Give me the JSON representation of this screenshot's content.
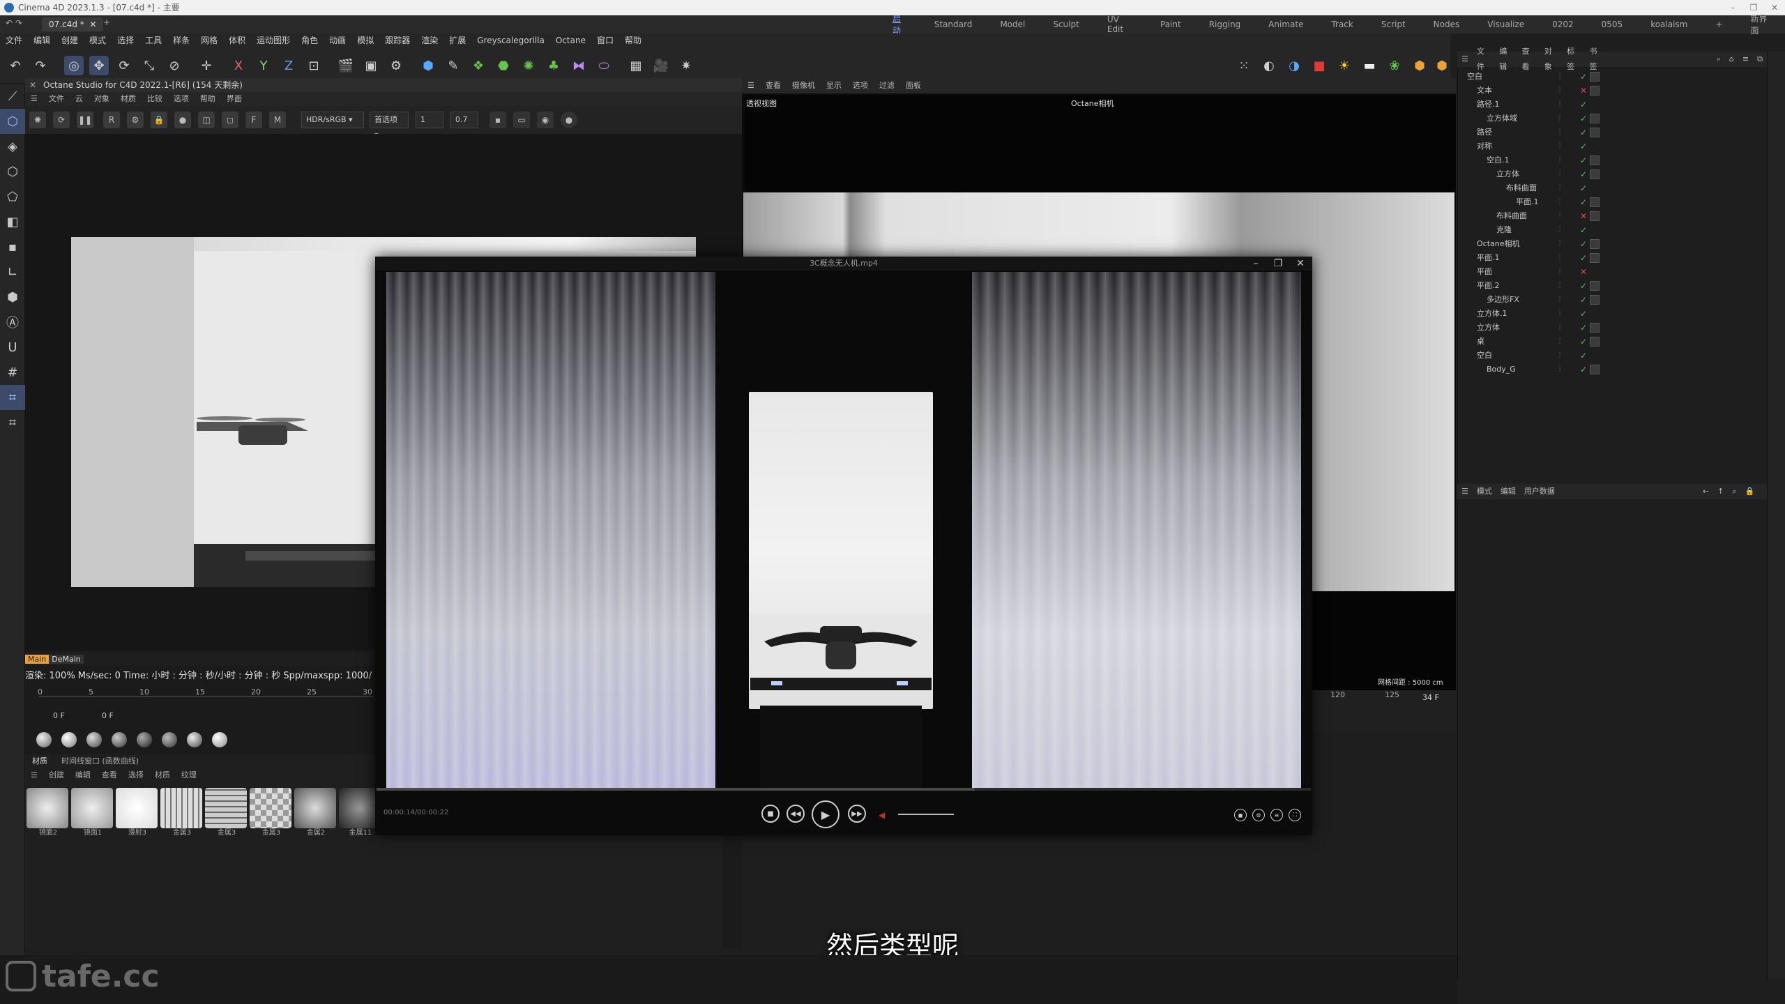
{
  "window": {
    "title": "Cinema 4D 2023.1.3 - [07.c4d *] - 主要"
  },
  "layout_bar": {
    "doc_tab": "07.c4d *",
    "layouts": [
      "启动",
      "Standard",
      "Model",
      "Sculpt",
      "UV Edit",
      "Paint",
      "Rigging",
      "Animate",
      "Track",
      "Script",
      "Nodes",
      "Visualize",
      "0202",
      "0505",
      "koalaism"
    ],
    "active_layout": "启动",
    "new_interface": "新界面"
  },
  "menu": [
    "文件",
    "编辑",
    "创建",
    "模式",
    "选择",
    "工具",
    "样条",
    "网格",
    "体积",
    "运动图形",
    "角色",
    "动画",
    "模拟",
    "跟踪器",
    "渲染",
    "扩展",
    "Greyscalegorilla",
    "Octane",
    "窗口",
    "帮助"
  ],
  "octane_viewer": {
    "title": "Octane Studio for C4D 2022.1-[R6] (154 天剩余)",
    "menu": [
      "文件",
      "云",
      "对象",
      "材质",
      "比较",
      "选项",
      "帮助",
      "界面"
    ],
    "mode": "HDR/sRGB",
    "pass": "首选项",
    "value1": "1",
    "value2": "0.7",
    "tag_main": "Main",
    "tag_demain": "DeMain",
    "status": "渲染: 100%   Ms/sec: 0   Time: 小时 : 分钟 : 秒/小时 : 分钟 : 秒   Spp/maxspp: 1000/",
    "timeline_ticks": [
      "0",
      "5",
      "10",
      "15",
      "20",
      "25",
      "30"
    ],
    "frame_start": "0 F",
    "frame_cur": "0 F"
  },
  "material_manager": {
    "tabs": [
      "材质",
      "时间线窗口 (函数曲线)"
    ],
    "menu": [
      "创建",
      "编辑",
      "查看",
      "选择",
      "材质",
      "纹理"
    ],
    "materials": [
      {
        "name": "镜面2",
        "color": "#b9b9b9"
      },
      {
        "name": "镜面1",
        "color": "#c4c4c4"
      },
      {
        "name": "漫射3",
        "color": "#ffffff"
      },
      {
        "name": "金属3",
        "color": "#dcdcdc"
      },
      {
        "name": "金属3",
        "color": "#cfcfcf"
      },
      {
        "name": "金属3",
        "color": "#e0e0e0"
      },
      {
        "name": "金属2",
        "color": "#bdbdbd"
      },
      {
        "name": "金属11",
        "color": "#555555"
      }
    ]
  },
  "viewport": {
    "menu": [
      "查看",
      "摄像机",
      "显示",
      "选项",
      "过滤",
      "面板"
    ],
    "label": "透视视图",
    "camera": "Octane相机",
    "grid_label": "网格间距 : 5000 cm",
    "frame": "34 F",
    "ticks": [
      "120",
      "125"
    ]
  },
  "object_manager": {
    "menu": [
      "文件",
      "编辑",
      "查看",
      "对象",
      "标签",
      "书签"
    ],
    "items": [
      {
        "name": "空白",
        "indent": 0
      },
      {
        "name": "文本",
        "indent": 1
      },
      {
        "name": "路径.1",
        "indent": 1
      },
      {
        "name": "立方体域",
        "indent": 2
      },
      {
        "name": "路径",
        "indent": 1
      },
      {
        "name": "对称",
        "indent": 1
      },
      {
        "name": "空白.1",
        "indent": 2
      },
      {
        "name": "立方体",
        "indent": 3
      },
      {
        "name": "布料曲面",
        "indent": 4
      },
      {
        "name": "平面.1",
        "indent": 5
      },
      {
        "name": "布料曲面",
        "indent": 3
      },
      {
        "name": "克隆",
        "indent": 3
      },
      {
        "name": "Octane相机",
        "indent": 1
      },
      {
        "name": "平面.1",
        "indent": 1
      },
      {
        "name": "平面",
        "indent": 1
      },
      {
        "name": "平面.2",
        "indent": 1
      },
      {
        "name": "多边形FX",
        "indent": 2
      },
      {
        "name": "立方体.1",
        "indent": 1
      },
      {
        "name": "立方体",
        "indent": 1
      },
      {
        "name": "桌",
        "indent": 1
      },
      {
        "name": "空白",
        "indent": 1
      },
      {
        "name": "Body_G",
        "indent": 2
      }
    ]
  },
  "attributes": {
    "menu": [
      "模式",
      "编辑",
      "用户数据"
    ]
  },
  "player": {
    "title": "3C概念无人机.mp4",
    "time": "00:00:14/00:00:22",
    "progress": 0.64
  },
  "subtitle": "然后类型呢",
  "watermark": "tafe.cc",
  "colors": {
    "accent": "#7fa2ff",
    "check_green": "#56c25a",
    "cross_red": "#e04848"
  }
}
